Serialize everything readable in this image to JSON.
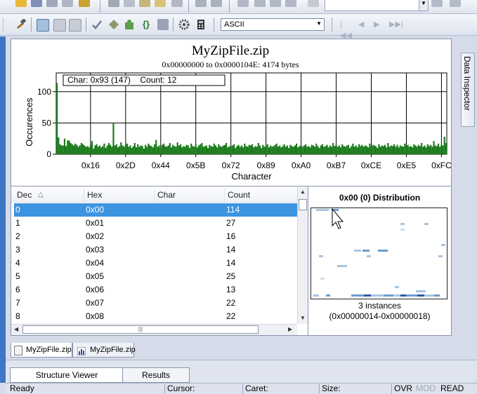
{
  "toolbar2": {
    "encoding_value": "ASCII"
  },
  "histogram": {
    "title": "MyZipFile.zip",
    "subtitle": "0x00000000 to 0x0000104E: 4174 bytes",
    "tooltip": "Char: 0x93 (147)    Count: 12",
    "ylabel": "Occurences",
    "xlabel": "Character"
  },
  "chart_data": {
    "type": "bar",
    "title": "MyZipFile.zip",
    "subtitle": "0x00000000 to 0x0000104E: 4174 bytes",
    "xlabel": "Character",
    "ylabel": "Occurences",
    "ylim": [
      0,
      130
    ],
    "yticks": [
      0,
      50,
      100
    ],
    "xtick_labels": [
      "0x16",
      "0x2D",
      "0x44",
      "0x5B",
      "0x72",
      "0x89",
      "0xA0",
      "0xB7",
      "0xCE",
      "0xE5",
      "0xFC"
    ],
    "xtick_values": [
      22,
      45,
      68,
      91,
      114,
      137,
      160,
      183,
      206,
      229,
      252
    ],
    "grid": true,
    "colors": {
      "bar": "#1a7a1a"
    },
    "highlight": {
      "char": 147,
      "count": 12
    },
    "values": [
      114,
      27,
      16,
      14,
      14,
      25,
      13,
      22,
      22,
      18,
      16,
      14,
      17,
      15,
      12,
      14,
      18,
      16,
      14,
      12,
      13,
      11,
      15,
      21,
      9,
      14,
      16,
      12,
      14,
      11,
      13,
      17,
      10,
      14,
      18,
      15,
      12,
      50,
      14,
      16,
      11,
      13,
      19,
      14,
      12,
      15,
      17,
      12,
      14,
      10,
      13,
      18,
      11,
      16,
      12,
      14,
      13,
      9,
      15,
      12,
      17,
      14,
      13,
      11,
      16,
      23,
      12,
      14,
      10,
      15,
      17,
      13,
      12,
      14,
      18,
      11,
      15,
      13,
      12,
      19,
      14,
      16,
      11,
      13,
      12,
      15,
      14,
      10,
      17,
      13,
      12,
      15,
      11,
      14,
      16,
      18,
      12,
      13,
      14,
      10,
      15,
      13,
      12,
      17,
      14,
      11,
      16,
      13,
      12,
      14,
      15,
      18,
      11,
      13,
      12,
      14,
      16,
      10,
      13,
      15,
      12,
      14,
      11,
      17,
      13,
      12,
      15,
      14,
      16,
      11,
      13,
      12,
      18,
      14,
      10,
      15,
      12,
      13,
      16,
      11,
      14,
      12,
      13,
      15,
      17,
      12,
      14,
      11,
      13,
      16,
      12,
      14,
      10,
      15,
      13,
      12,
      14,
      17,
      11,
      13,
      15,
      12,
      14,
      16,
      12,
      13,
      11,
      15,
      14,
      12,
      17,
      13,
      10,
      14,
      16,
      12,
      13,
      15,
      11,
      14,
      12,
      18,
      13,
      15,
      12,
      14,
      11,
      16,
      13,
      12,
      14,
      15,
      10,
      13,
      17,
      12,
      14,
      11,
      16,
      13,
      15,
      12,
      14,
      13,
      11,
      17,
      12,
      15,
      14,
      13,
      10,
      16,
      12,
      14,
      13,
      15,
      11,
      18,
      12,
      14,
      13,
      16,
      12,
      15,
      11,
      14,
      13,
      12,
      17,
      14,
      15,
      12,
      13,
      11,
      16,
      14,
      12,
      15,
      13,
      18,
      12,
      14,
      11,
      16,
      13,
      15,
      12,
      21,
      14,
      13,
      17,
      12,
      15,
      14,
      28,
      18
    ]
  },
  "table": {
    "columns": [
      "Dec",
      "Hex",
      "Char",
      "Count"
    ],
    "rows": [
      {
        "dec": "0",
        "hex": "0x00",
        "char": "",
        "count": "114"
      },
      {
        "dec": "1",
        "hex": "0x01",
        "char": "",
        "count": "27"
      },
      {
        "dec": "2",
        "hex": "0x02",
        "char": "",
        "count": "16"
      },
      {
        "dec": "3",
        "hex": "0x03",
        "char": "",
        "count": "14"
      },
      {
        "dec": "4",
        "hex": "0x04",
        "char": "",
        "count": "14"
      },
      {
        "dec": "5",
        "hex": "0x05",
        "char": "",
        "count": "25"
      },
      {
        "dec": "6",
        "hex": "0x06",
        "char": "",
        "count": "13"
      },
      {
        "dec": "7",
        "hex": "0x07",
        "char": "",
        "count": "22"
      },
      {
        "dec": "8",
        "hex": "0x08",
        "char": "",
        "count": "22"
      }
    ]
  },
  "distribution": {
    "title": "0x00 (0) Distribution",
    "instances": "3 instances",
    "range": "(0x00000014-0x00000018)"
  },
  "side_tab": {
    "label": "Data Inspector"
  },
  "doc_tabs": [
    {
      "label": "MyZipFile.zip"
    },
    {
      "label": "MyZipFile.zip"
    }
  ],
  "bottom_tabs": [
    {
      "label": "Structure Viewer"
    },
    {
      "label": "Results"
    }
  ],
  "status": {
    "ready": "Ready",
    "cursor": "Cursor:",
    "caret": "Caret:",
    "size": "Size:",
    "ovr": "OVR",
    "mod": "MOD",
    "read": "READ"
  }
}
